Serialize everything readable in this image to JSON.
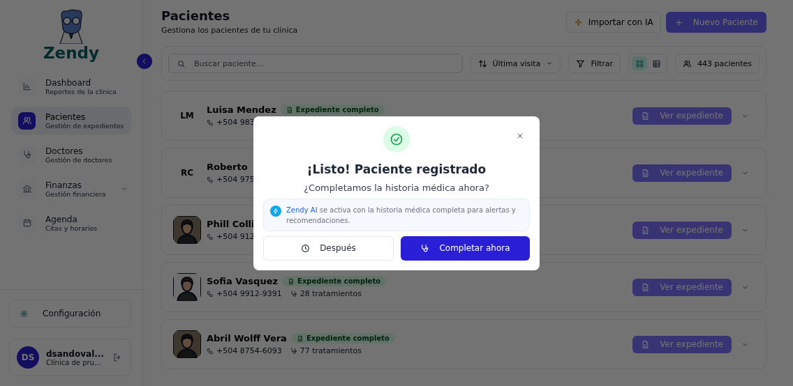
{
  "sidebar": {
    "brand": "Zendy",
    "items": [
      {
        "kind": "link",
        "title": "Dashboard",
        "subtitle": "Reportes de la clínica",
        "selected": false
      },
      {
        "kind": "link",
        "title": "Pacientes",
        "subtitle": "Gestión de expedientes",
        "selected": true
      },
      {
        "kind": "link",
        "title": "Doctores",
        "subtitle": "Gestión de doctores",
        "selected": false
      },
      {
        "kind": "group",
        "title": "Finanzas",
        "subtitle": "Gestión financiera",
        "selected": false
      },
      {
        "kind": "link",
        "title": "Agenda",
        "subtitle": "Citas y horarios",
        "selected": false
      }
    ],
    "settings": "Configuración",
    "user": {
      "initials": "DS",
      "name": "dsandoval...",
      "clinic": "Clínica de pru..."
    }
  },
  "header": {
    "title": "Pacientes",
    "subtitle": "Gestiona los pacientes de tu clínica",
    "import_button": "Importar con IA",
    "new_button": "Nuevo Paciente"
  },
  "toolbar": {
    "search": {
      "placeholder": "Buscar paciente..."
    },
    "sort": "Última visita",
    "filter": "Filtrar",
    "views": [
      {
        "kind": "grid",
        "selected": true
      },
      {
        "kind": "table",
        "selected": false
      }
    ],
    "count": "443 pacientes"
  },
  "patients": [
    {
      "avatar": {
        "kind": "initials",
        "text": "LM"
      },
      "name": "Luisa Mendez",
      "badge": "Expediente completo",
      "phone": "+504 983",
      "action": "Ver expediente"
    },
    {
      "avatar": {
        "kind": "initials",
        "text": "RC"
      },
      "name": "Roberto",
      "phone": "+504 975",
      "action": "Ver expediente"
    },
    {
      "name": "Phill Colli",
      "phone": "+504 912",
      "action": "Ver expediente"
    },
    {
      "name": "Sofia Vasquez",
      "badge": "Expediente completo",
      "phone": "+504 9912-9391",
      "treatments": "28 tratamientos",
      "action": "Ver expediente"
    },
    {
      "name": "Abril Wolff Vera",
      "badge": "Expediente completo",
      "phone": "+504 8754-6093",
      "treatments": "77 tratamientos",
      "action": "Ver expediente"
    }
  ],
  "modal": {
    "title": "¡Listo! Paciente registrado",
    "question": "¿Completamos la historia médica ahora?",
    "info": {
      "highlight": "Zendy AI",
      "text": "se activa con la historia médica completa para alertas y recomendaciones."
    },
    "secondary_button": "Después",
    "primary_button": "Completar ahora"
  }
}
